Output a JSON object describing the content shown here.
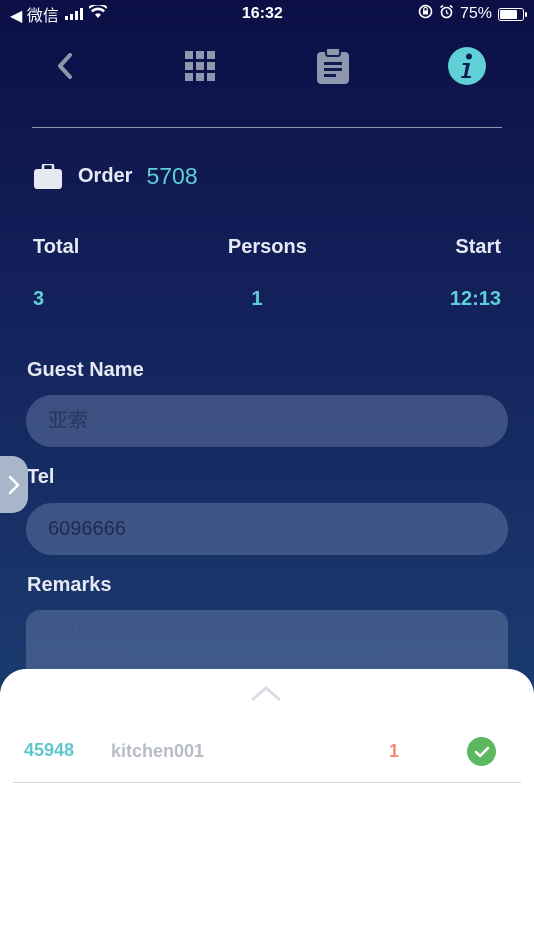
{
  "status_bar": {
    "back_app": "◀ 微信",
    "time": "16:32",
    "battery_text": "75%",
    "battery_level": 0.75
  },
  "toolbar": {
    "icons": [
      "chevron-left-icon",
      "grid-icon",
      "clipboard-icon",
      "info-icon"
    ],
    "accent_color": "#5fd0d6"
  },
  "order": {
    "label": "Order",
    "number": "5708"
  },
  "stats": {
    "headers": [
      "Total",
      "Persons",
      "Start"
    ],
    "values": [
      "3",
      "1",
      "12:13"
    ]
  },
  "guest_name": {
    "label": "Guest Name",
    "placeholder": "亚索",
    "value": ""
  },
  "tel": {
    "label": "Tel",
    "value": "6096666"
  },
  "remarks": {
    "label": "Remarks",
    "placeholder": "Insert remark"
  },
  "sheet": {
    "rows": [
      {
        "id": "45948",
        "name": "kitchen001",
        "qty": "1",
        "status": "done"
      }
    ]
  }
}
